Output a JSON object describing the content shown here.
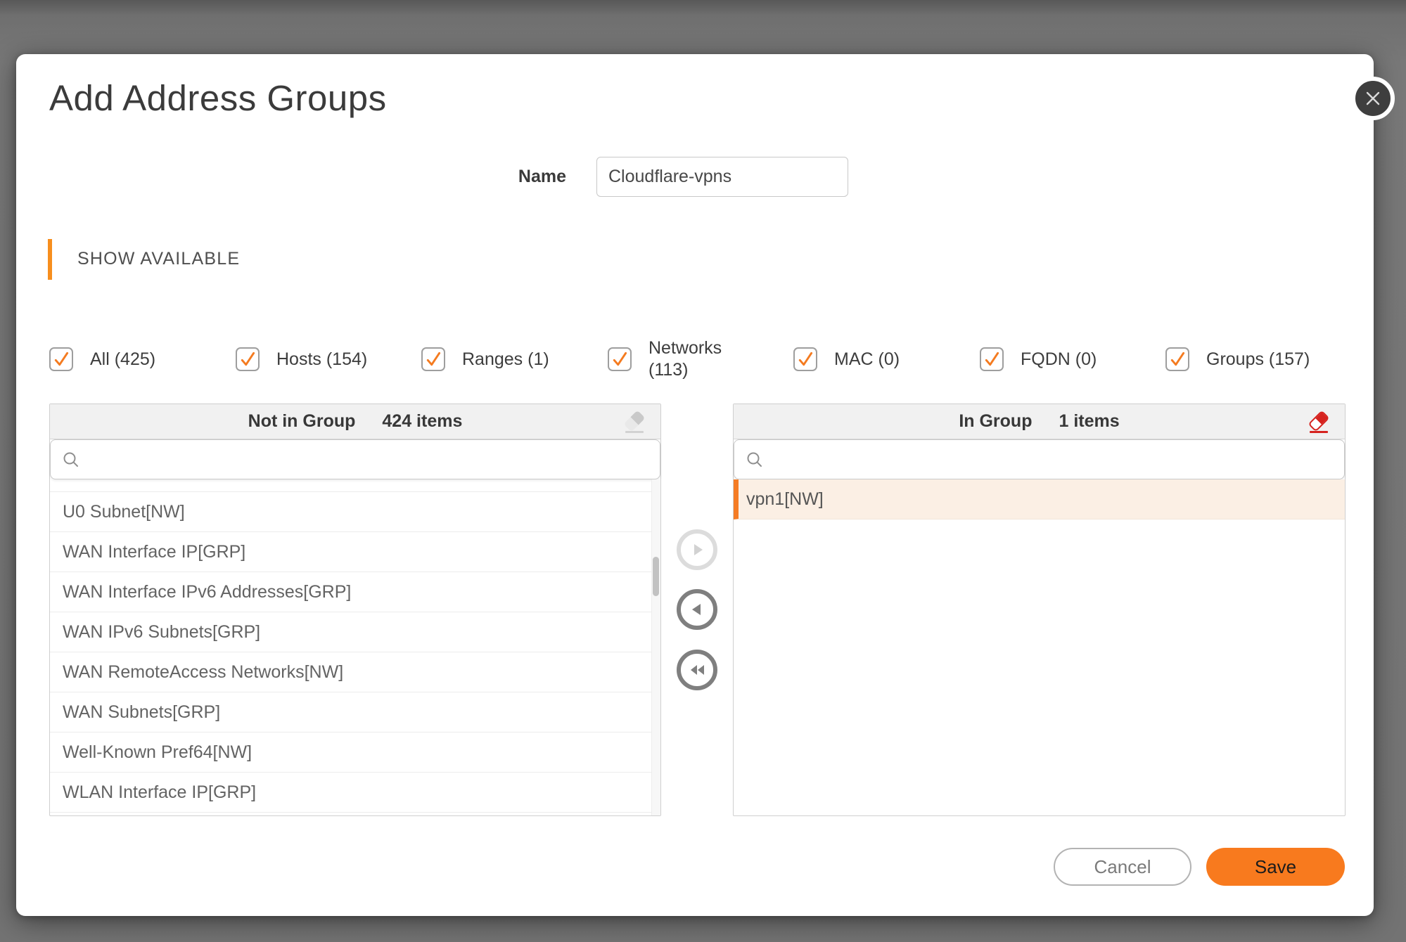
{
  "modal": {
    "title": "Add Address Groups"
  },
  "name_field": {
    "label": "Name",
    "value": "Cloudflare-vpns"
  },
  "show_available": {
    "label": "SHOW AVAILABLE"
  },
  "filters": [
    {
      "id": "all",
      "line1": "All (425)",
      "checked": true
    },
    {
      "id": "hosts",
      "line1": "Hosts (154)",
      "checked": true
    },
    {
      "id": "ranges",
      "line1": "Ranges (1)",
      "checked": true
    },
    {
      "id": "networks",
      "line1": "Networks",
      "line2": "(113)",
      "checked": true
    },
    {
      "id": "mac",
      "line1": "MAC (0)",
      "checked": true
    },
    {
      "id": "fqdn",
      "line1": "FQDN (0)",
      "checked": true
    },
    {
      "id": "groups",
      "line1": "Groups (157)",
      "checked": true
    }
  ],
  "not_in_group": {
    "title": "Not in Group",
    "count": "424 items",
    "search": {
      "value": "",
      "placeholder": ""
    },
    "items": [
      "U0 Subnet[NW]",
      "WAN Interface IP[GRP]",
      "WAN Interface IPv6 Addresses[GRP]",
      "WAN IPv6 Subnets[GRP]",
      "WAN RemoteAccess Networks[NW]",
      "WAN Subnets[GRP]",
      "Well-Known Pref64[NW]",
      "WLAN Interface IP[GRP]"
    ]
  },
  "in_group": {
    "title": "In Group",
    "count": "1 items",
    "search": {
      "value": "",
      "placeholder": ""
    },
    "items": [
      "vpn1[NW]"
    ],
    "selected_index": 0
  },
  "footer": {
    "cancel_label": "Cancel",
    "save_label": "Save"
  },
  "colors": {
    "accent_orange": "#F47B20",
    "section_bar_orange": "#F78E1E",
    "save_button_orange": "#F87A1E",
    "selected_row_background": "#FBEFE4",
    "danger_red": "#D6231F",
    "panel_header_background": "#F1F1F1"
  }
}
